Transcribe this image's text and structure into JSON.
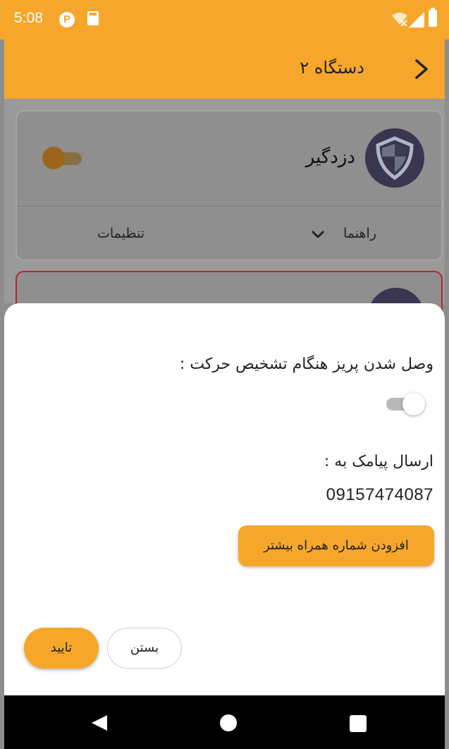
{
  "status_bar": {
    "time": "5:08",
    "icons": [
      "p-icon",
      "sd-card-icon",
      "wifi-icon",
      "signal-icon",
      "battery-icon"
    ]
  },
  "app_bar": {
    "title": "دستگاه ۲",
    "back_icon": "chevron-right-icon"
  },
  "device_card": {
    "title": "دزدگیر",
    "icon": "shield-icon",
    "toggle_on": false,
    "help_label": "راهنما",
    "settings_label": "تنظیمات"
  },
  "dialog": {
    "motion_question": "وصل شدن پریز هنگام تشخیص حرکت :",
    "motion_switch_on": false,
    "sms_label": "ارسال پیامک به :",
    "phone_number": "09157474087",
    "add_button": "افزودن شماره همراه بیشتر",
    "close_button": "بستن",
    "confirm_button": "تایید"
  },
  "colors": {
    "accent": "#f6a72b",
    "card_border_alert": "#b3282a",
    "avatar": "#4b3f7a"
  },
  "nav_bar": {
    "icons": [
      "back-icon",
      "home-icon",
      "recents-icon"
    ]
  }
}
